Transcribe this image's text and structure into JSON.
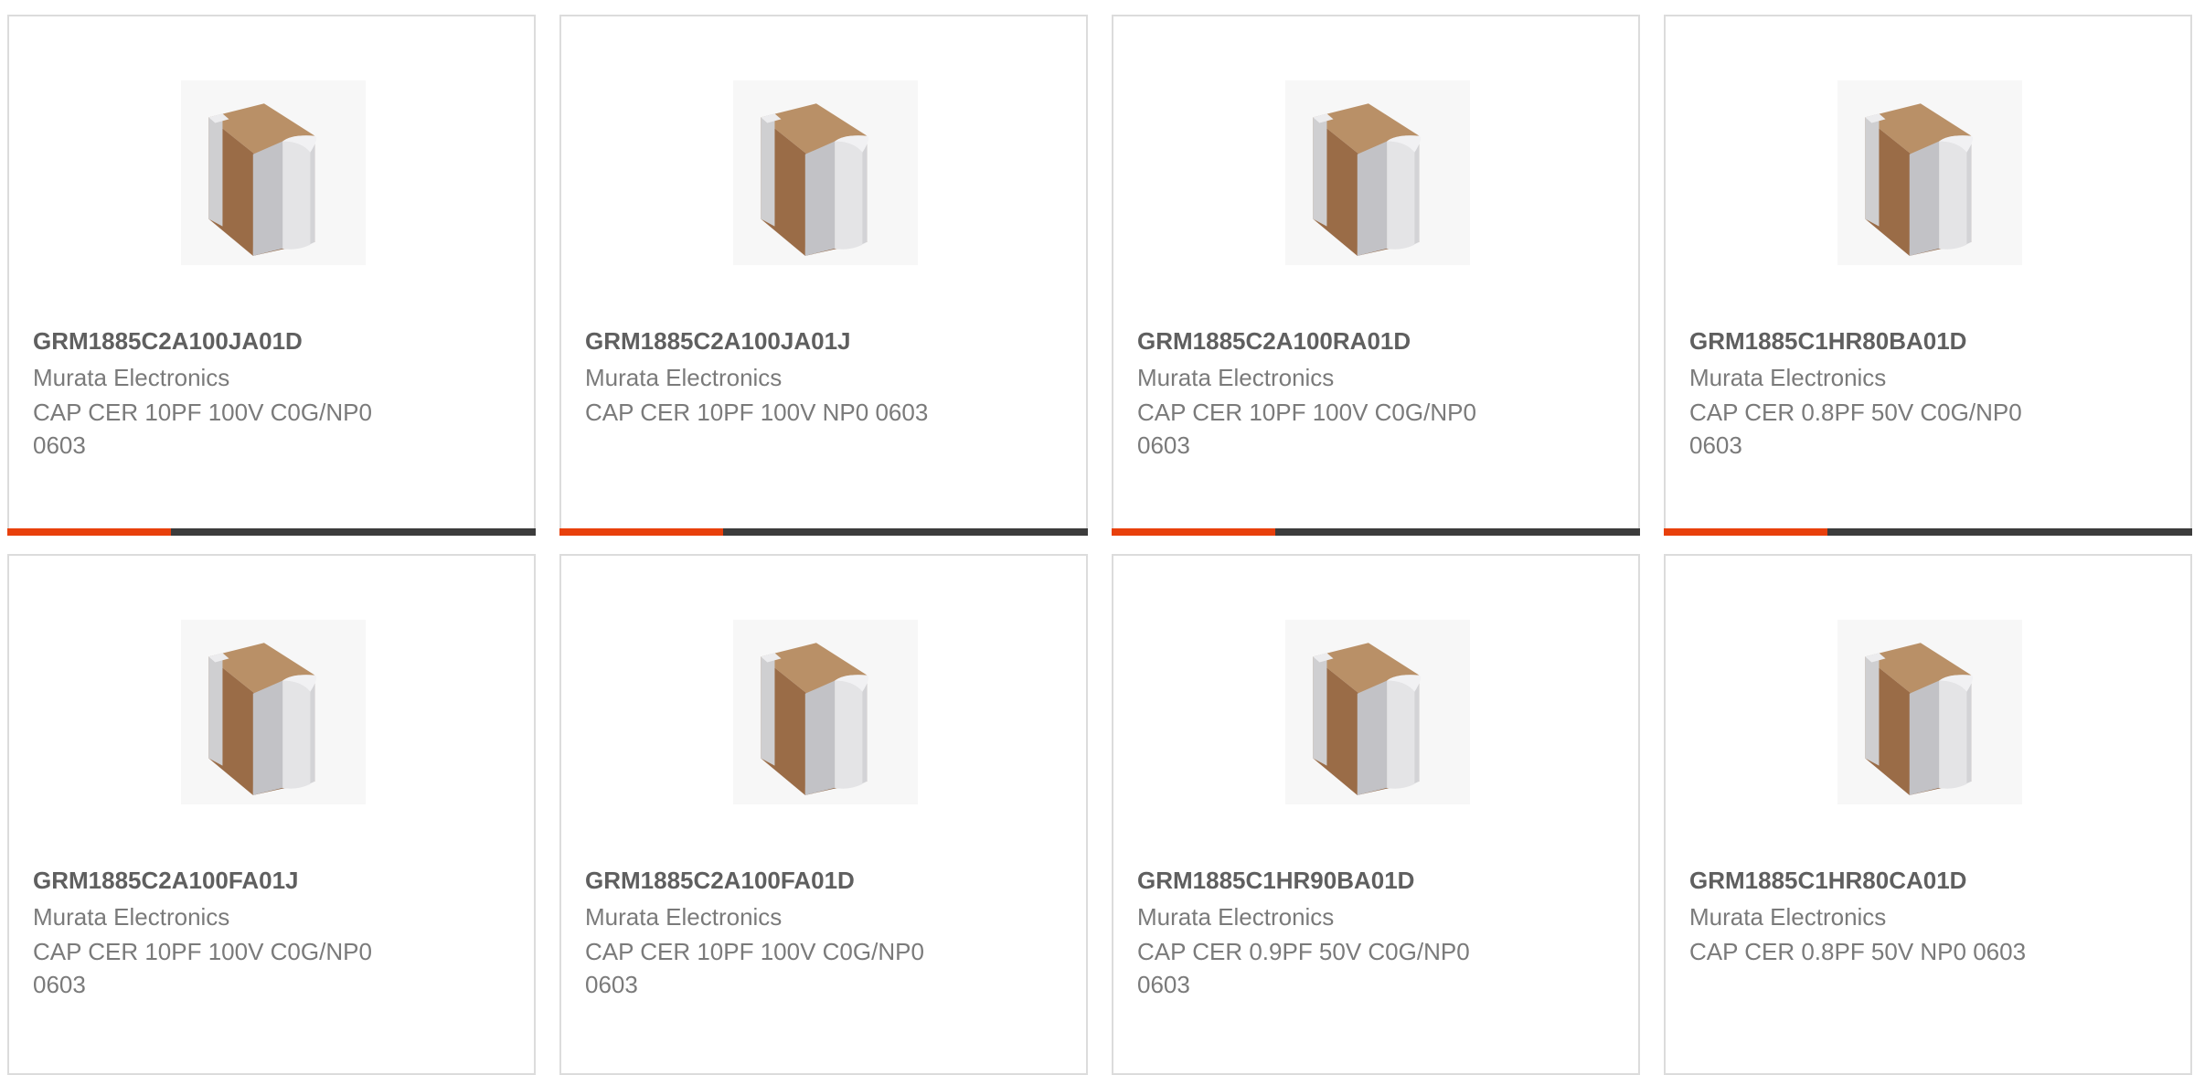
{
  "colors": {
    "progress_fill": "#e8400c",
    "progress_track": "#3c3c3c",
    "card_border": "#dcdcdc",
    "part_number_text": "#5f5f5f",
    "body_text": "#7a7a7a"
  },
  "products": [
    {
      "part_number": "GRM1885C2A100JA01D",
      "manufacturer": "Murata Electronics",
      "description": "CAP CER 10PF 100V C0G/NP0 0603",
      "icon": "ceramic-capacitor-chip-icon",
      "progress": 0.31
    },
    {
      "part_number": "GRM1885C2A100JA01J",
      "manufacturer": "Murata Electronics",
      "description": "CAP CER 10PF 100V NP0 0603",
      "icon": "ceramic-capacitor-chip-icon",
      "progress": 0.31
    },
    {
      "part_number": "GRM1885C2A100RA01D",
      "manufacturer": "Murata Electronics",
      "description": "CAP CER 10PF 100V C0G/NP0 0603",
      "icon": "ceramic-capacitor-chip-icon",
      "progress": 0.31
    },
    {
      "part_number": "GRM1885C1HR80BA01D",
      "manufacturer": "Murata Electronics",
      "description": "CAP CER 0.8PF 50V C0G/NP0 0603",
      "icon": "ceramic-capacitor-chip-icon",
      "progress": 0.31
    },
    {
      "part_number": "GRM1885C2A100FA01J",
      "manufacturer": "Murata Electronics",
      "description": "CAP CER 10PF 100V C0G/NP0 0603",
      "icon": "ceramic-capacitor-chip-icon"
    },
    {
      "part_number": "GRM1885C2A100FA01D",
      "manufacturer": "Murata Electronics",
      "description": "CAP CER 10PF 100V C0G/NP0 0603",
      "icon": "ceramic-capacitor-chip-icon"
    },
    {
      "part_number": "GRM1885C1HR90BA01D",
      "manufacturer": "Murata Electronics",
      "description": "CAP CER 0.9PF 50V C0G/NP0 0603",
      "icon": "ceramic-capacitor-chip-icon"
    },
    {
      "part_number": "GRM1885C1HR80CA01D",
      "manufacturer": "Murata Electronics",
      "description": "CAP CER 0.8PF 50V NP0 0603",
      "icon": "ceramic-capacitor-chip-icon"
    }
  ]
}
